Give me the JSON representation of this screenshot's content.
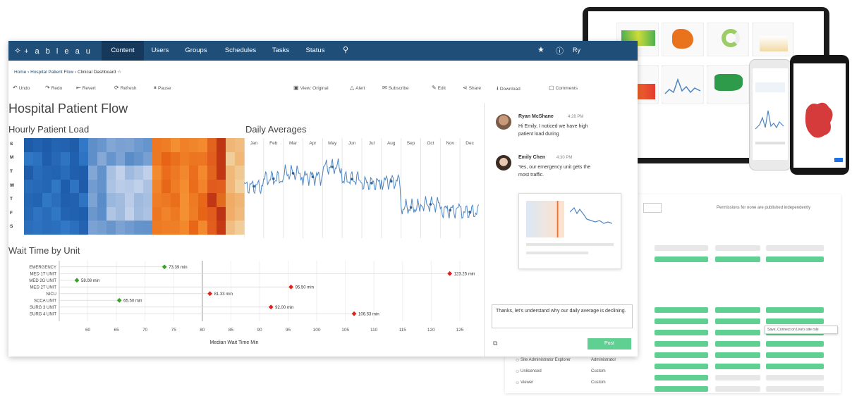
{
  "colors": {
    "nav": "#1f4e79",
    "nav_active": "#16395b",
    "accent_green": "#5fcf92",
    "diamond_green": "#3a9e29",
    "diamond_red": "#e0201b",
    "line_blue": "#4e86c2",
    "heat_blue": "#2d6bb0",
    "heat_orange": "#e3641b"
  },
  "app": {
    "logo": "+ a b l e a u",
    "nav": [
      "Content",
      "Users",
      "Groups",
      "Schedules",
      "Tasks",
      "Status"
    ],
    "active_tab": "Content",
    "user_initials": "Ry"
  },
  "breadcrumb": [
    "Home",
    "Hospital Patient Flow",
    "Clinical Dashboard"
  ],
  "toolbar": {
    "left": [
      "Undo",
      "Redo",
      "Revert",
      "Refresh",
      "Pause"
    ],
    "right": [
      "View: Original",
      "Alert",
      "Subscribe",
      "Edit",
      "Share",
      "Download",
      "Comments"
    ]
  },
  "dashboard": {
    "title": "Hospital Patient Flow",
    "heatmap_title": "Hourly Patient Load",
    "days": [
      "S",
      "M",
      "T",
      "W",
      "T",
      "F",
      "S"
    ],
    "line_title": "Daily Averages",
    "months": [
      "Jan",
      "Feb",
      "Mar",
      "Apr",
      "May",
      "Jun",
      "Jul",
      "Aug",
      "Sep",
      "Oct",
      "Nov",
      "Dec"
    ],
    "wait_title": "Wait Time by Unit"
  },
  "chart_data": [
    {
      "type": "heatmap",
      "title": "Hourly Patient Load",
      "rows": [
        "S",
        "M",
        "T",
        "W",
        "T",
        "F",
        "S"
      ]
    },
    {
      "type": "line",
      "title": "Daily Averages",
      "categories": [
        "Jan",
        "Feb",
        "Mar",
        "Apr",
        "May",
        "Jun",
        "Jul",
        "Aug",
        "Sep",
        "Oct",
        "Nov",
        "Dec"
      ],
      "values": [
        215,
        232,
        244,
        236,
        258,
        231,
        222,
        226,
        168,
        175,
        162,
        158
      ],
      "ylim": [
        100,
        300
      ]
    },
    {
      "type": "scatter",
      "title": "Wait Time by Unit",
      "xlabel": "Median Wait Time Min",
      "xlim": [
        55,
        126
      ],
      "xticks": [
        60,
        65,
        70,
        75,
        80,
        85,
        90,
        95,
        100,
        105,
        110,
        115,
        120,
        125
      ],
      "target": 80,
      "categories": [
        "EMERGENCY",
        "MED 1T UNIT",
        "MED 2G UNIT",
        "MED 2T UNIT",
        "NICU",
        "SCCA UNIT",
        "SURG 3 UNIT",
        "SURG 4 UNIT"
      ],
      "values": [
        73.39,
        123.25,
        58.08,
        95.5,
        81.33,
        65.5,
        92.0,
        106.53
      ],
      "labels": [
        "73.39 min",
        "123.25 min",
        "58.08 min",
        "95.50 min",
        "81.33 min",
        "65.50 min",
        "92.00 min",
        "106.53 min"
      ],
      "status": [
        "good",
        "bad",
        "good",
        "bad",
        "bad",
        "good",
        "bad",
        "bad"
      ]
    }
  ],
  "comments": [
    {
      "name": "Ryan McShane",
      "time": "4:28 PM",
      "text": "Hi Emily, I noticed we have high patient load during"
    },
    {
      "name": "Emily Chen",
      "time": "4:30 PM",
      "text": "Yes, our emergency unit gets the most traffic."
    }
  ],
  "reply": {
    "text": "Thanks, let's understand why our daily average is declining.",
    "post_label": "Post"
  },
  "admin": {
    "note": "Permissions for none are published independently",
    "tooltip": "Save, Connect on Live's site role",
    "users": [
      {
        "name": "Site Administrator Explorer",
        "role": "Administrator"
      },
      {
        "name": "Unlicensed",
        "role": "Custom"
      },
      {
        "name": "Viewer",
        "role": "Custom"
      }
    ]
  }
}
